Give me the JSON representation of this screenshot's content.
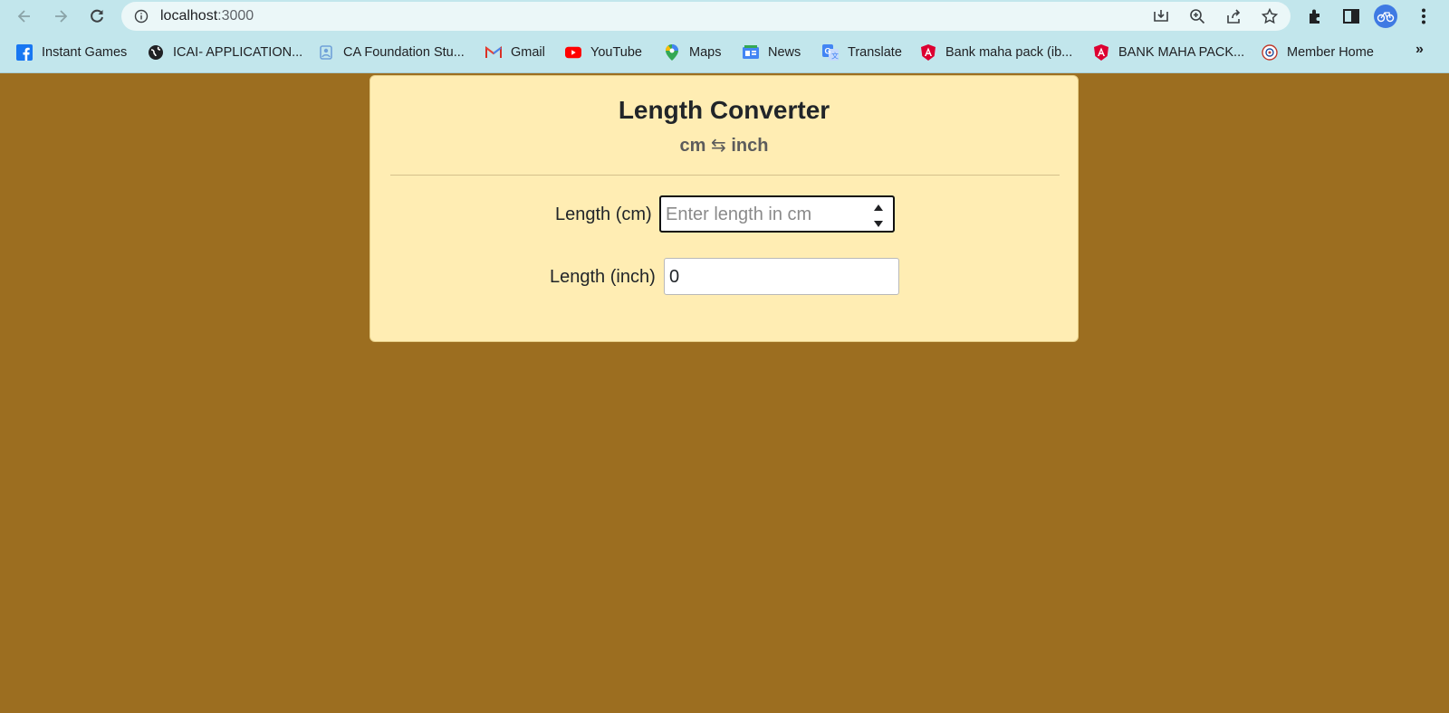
{
  "browser": {
    "url_host": "localhost",
    "url_port": ":3000",
    "bookmarks": [
      {
        "label": "Instant Games",
        "icon": "facebook-icon"
      },
      {
        "label": "ICAI- APPLICATION...",
        "icon": "globe-icon"
      },
      {
        "label": "CA Foundation Stu...",
        "icon": "study-icon"
      },
      {
        "label": "Gmail",
        "icon": "gmail-icon"
      },
      {
        "label": "YouTube",
        "icon": "youtube-icon"
      },
      {
        "label": "Maps",
        "icon": "maps-icon"
      },
      {
        "label": "News",
        "icon": "news-icon"
      },
      {
        "label": "Translate",
        "icon": "translate-icon"
      },
      {
        "label": "Bank maha pack (ib...",
        "icon": "angular-icon"
      },
      {
        "label": "BANK MAHA PACK...",
        "icon": "angular-icon"
      },
      {
        "label": "Member Home",
        "icon": "member-icon"
      }
    ],
    "more_label": "»"
  },
  "app": {
    "title": "Length Converter",
    "subtitle_from": "cm",
    "subtitle_arrow": "⇆",
    "subtitle_to": "inch",
    "cm_label": "Length (cm)",
    "cm_placeholder": "Enter length in cm",
    "cm_value": "",
    "inch_label": "Length (inch)",
    "inch_value": "0"
  },
  "colors": {
    "page_background": "#9c6e20",
    "card_background": "#ffedb3",
    "chrome_background": "#c2e6ec"
  }
}
